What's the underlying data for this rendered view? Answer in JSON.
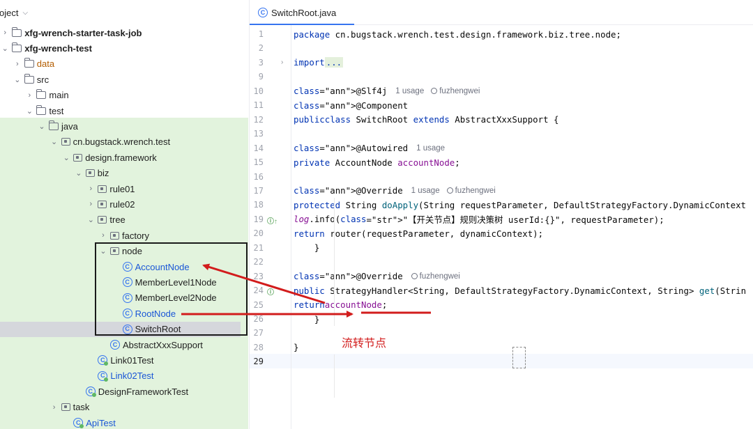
{
  "project": {
    "title": "oject",
    "tree": [
      {
        "label": "xfg-wrench-starter-task-job",
        "icon": "module-folder-icon",
        "chev": "collapsed",
        "bold": true
      },
      {
        "label": "xfg-wrench-test",
        "icon": "module-folder-icon",
        "chev": "expanded",
        "bold": true
      },
      {
        "label": "data",
        "icon": "folder-icon",
        "chev": "collapsed",
        "color": "orange"
      },
      {
        "label": "src",
        "icon": "folder-icon",
        "chev": "expanded"
      },
      {
        "label": "main",
        "icon": "folder-icon",
        "chev": "collapsed"
      },
      {
        "label": "test",
        "icon": "folder-icon",
        "chev": "expanded"
      },
      {
        "label": "java",
        "icon": "folder-icon",
        "chev": "expanded"
      },
      {
        "label": "cn.bugstack.wrench.test",
        "icon": "package-icon",
        "chev": "expanded"
      },
      {
        "label": "design.framework",
        "icon": "package-icon",
        "chev": "expanded"
      },
      {
        "label": "biz",
        "icon": "package-icon",
        "chev": "expanded"
      },
      {
        "label": "rule01",
        "icon": "package-icon",
        "chev": "collapsed"
      },
      {
        "label": "rule02",
        "icon": "package-icon",
        "chev": "collapsed"
      },
      {
        "label": "tree",
        "icon": "package-icon",
        "chev": "expanded"
      },
      {
        "label": "factory",
        "icon": "package-icon",
        "chev": "collapsed"
      },
      {
        "label": "node",
        "icon": "package-icon",
        "chev": "expanded"
      },
      {
        "label": "AccountNode",
        "icon": "class-icon",
        "color": "blue"
      },
      {
        "label": "MemberLevel1Node",
        "icon": "class-icon"
      },
      {
        "label": "MemberLevel2Node",
        "icon": "class-icon"
      },
      {
        "label": "RootNode",
        "icon": "class-icon",
        "color": "blue"
      },
      {
        "label": "SwitchRoot",
        "icon": "class-icon",
        "selected": true
      },
      {
        "label": "AbstractXxxSupport",
        "icon": "class-icon"
      },
      {
        "label": "Link01Test",
        "icon": "test-class-icon"
      },
      {
        "label": "Link02Test",
        "icon": "test-class-icon",
        "color": "blue"
      },
      {
        "label": "DesignFrameworkTest",
        "icon": "test-class-icon"
      },
      {
        "label": "task",
        "icon": "package-icon",
        "chev": "collapsed"
      },
      {
        "label": "ApiTest",
        "icon": "test-class-icon",
        "color": "blue"
      }
    ]
  },
  "editor": {
    "tab_label": "SwitchRoot.java",
    "current_line": "29",
    "code_lines": [
      {
        "n": "1",
        "t": "package cn.bugstack.wrench.test.design.framework.biz.tree.node;"
      },
      {
        "n": "2",
        "t": ""
      },
      {
        "n": "3",
        "t": "import ..."
      },
      {
        "n": "9",
        "t": ""
      },
      {
        "n": "10",
        "t": "@Slf4j",
        "hint_usage": "1 usage",
        "hint_author": "fuzhengwei"
      },
      {
        "n": "11",
        "t": "@Component"
      },
      {
        "n": "12",
        "t": "public class SwitchRoot extends AbstractXxxSupport {"
      },
      {
        "n": "13",
        "t": ""
      },
      {
        "n": "14",
        "t": "    @Autowired",
        "hint_usage": "1 usage"
      },
      {
        "n": "15",
        "t": "    private AccountNode accountNode;"
      },
      {
        "n": "16",
        "t": ""
      },
      {
        "n": "17",
        "t": "    @Override",
        "hint_usage": "1 usage",
        "hint_author": "fuzhengwei"
      },
      {
        "n": "18",
        "t": "    protected String doApply(String requestParameter, DefaultStrategyFactory.DynamicContext"
      },
      {
        "n": "19",
        "t": "        log.info(\"【开关节点】规则决策树 userId:{}\", requestParameter);"
      },
      {
        "n": "20",
        "t": "        return router(requestParameter, dynamicContext);"
      },
      {
        "n": "21",
        "t": "    }"
      },
      {
        "n": "22",
        "t": ""
      },
      {
        "n": "23",
        "t": "    @Override",
        "hint_author": "fuzhengwei"
      },
      {
        "n": "24",
        "t": "    public StrategyHandler<String, DefaultStrategyFactory.DynamicContext, String> get(Strin"
      },
      {
        "n": "25",
        "t": "        return accountNode;"
      },
      {
        "n": "26",
        "t": "    }"
      },
      {
        "n": "27",
        "t": ""
      },
      {
        "n": "28",
        "t": "}"
      },
      {
        "n": "29",
        "t": ""
      }
    ]
  },
  "annotation": {
    "caption": "流转节点",
    "color": "#d21c1c"
  }
}
